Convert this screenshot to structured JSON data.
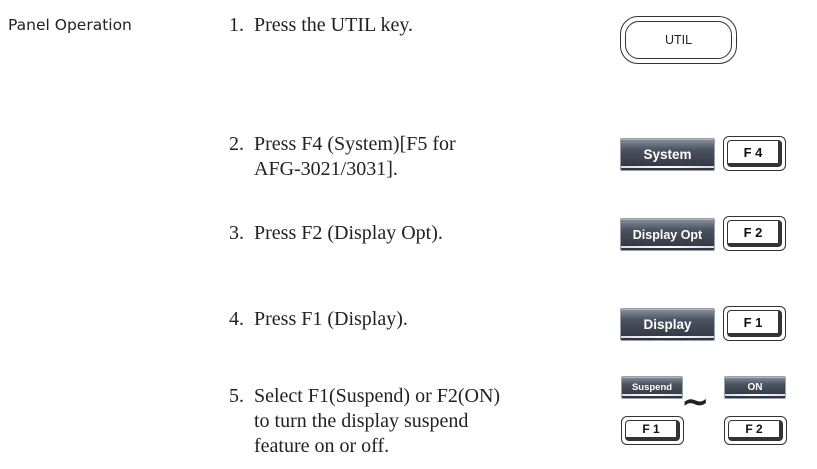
{
  "section_label": "Panel Operation",
  "steps": [
    {
      "num": "1.",
      "lines": [
        "Press the UTIL key."
      ]
    },
    {
      "num": "2.",
      "lines": [
        "Press F4 (System)[F5 for",
        "AFG-3021/3031]."
      ]
    },
    {
      "num": "3.",
      "lines": [
        "Press F2 (Display Opt)."
      ]
    },
    {
      "num": "4.",
      "lines": [
        "Press F1 (Display)."
      ]
    },
    {
      "num": "5.",
      "lines": [
        "Select F1(Suspend) or F2(ON)",
        "to turn the display suspend",
        "feature on or off."
      ]
    }
  ],
  "keys": {
    "util": "UTIL",
    "system_label": "System",
    "f4": "F 4",
    "display_opt_label": "Display Opt",
    "f2_step3": "F 2",
    "display_label": "Display",
    "f1_step4": "F 1",
    "suspend_label": "Suspend",
    "f1_step5": "F 1",
    "tilde": "∼",
    "on_label": "ON",
    "f2_step5": "F 2"
  }
}
